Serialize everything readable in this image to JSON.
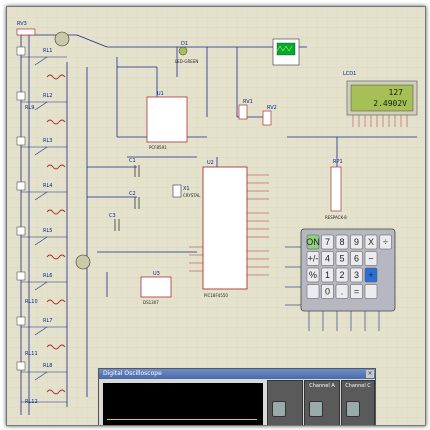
{
  "components": {
    "rv3": "RV3",
    "rl1": "RL1",
    "rl2": "RL2",
    "rl3": "RL3",
    "rl4": "RL4",
    "rl5": "RL5",
    "rl6": "RL6",
    "rl7": "RL7",
    "rl8": "RL8",
    "rl9": "RL9",
    "rl10": "RL10",
    "rl11": "RL11",
    "rl12": "RL12",
    "u1": "U1",
    "u2": "U2",
    "u3": "U3",
    "u4": "U4",
    "rv1": "RV1",
    "rv2": "RV2",
    "rp1": "RP1",
    "c1": "C1",
    "c2": "C2",
    "c3": "C3",
    "x1": "X1",
    "d1": "D1",
    "lcd1": "LCD1",
    "u1_part": "PCF8591",
    "u2_part": "PIC18F4550",
    "u3_part": "DS1307",
    "d1_part": "LED-GREEN",
    "x1_part": "CRYSTAL",
    "rp1_part": "RESPACK-8"
  },
  "lcd": {
    "line1": "127",
    "line2": "2.4902V"
  },
  "keypad": {
    "row1": [
      "ON",
      "7",
      "8",
      "9",
      "X",
      "÷"
    ],
    "row2": [
      "+/-",
      "4",
      "5",
      "6",
      "−",
      ""
    ],
    "row3": [
      "%",
      "1",
      "2",
      "3",
      "+",
      ""
    ],
    "row4": [
      "",
      "0",
      ".",
      "=",
      "",
      ""
    ]
  },
  "oscilloscope": {
    "title": "Digital Oscilloscope",
    "close": "×",
    "channel_a": "Channel A",
    "channel_c": "Channel C"
  },
  "colors": {
    "background": "#e4e2cc",
    "wire": "#1c2a8a",
    "body": "#b03030",
    "lcd": "#a7bf57",
    "osc_trace": "#e8d000"
  }
}
